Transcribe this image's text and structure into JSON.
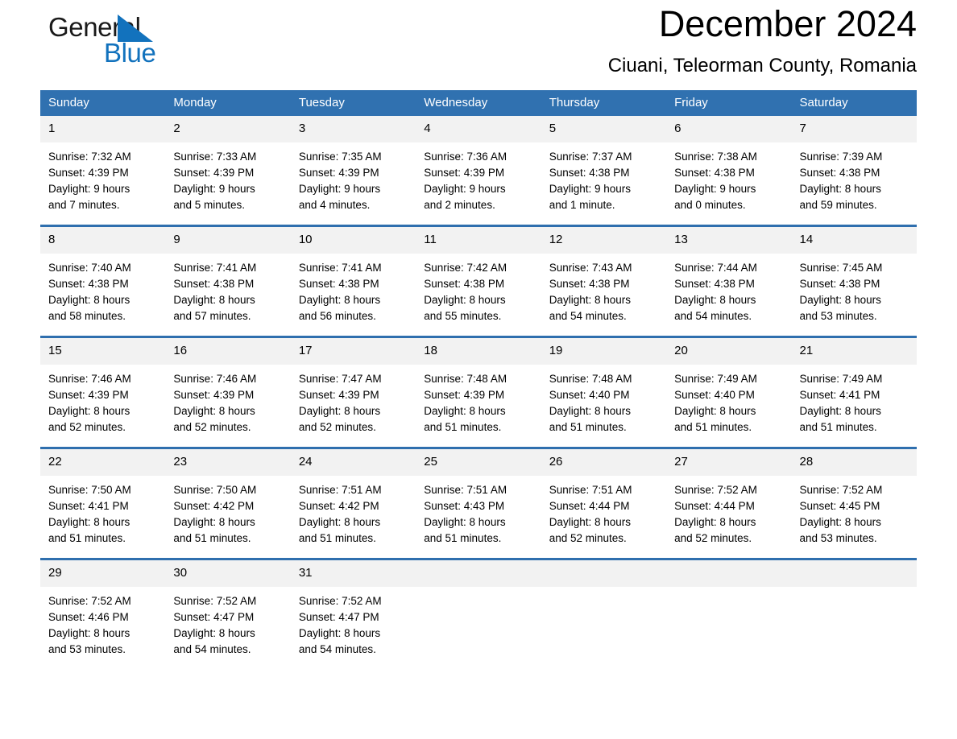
{
  "brand": {
    "line1": "General",
    "line2": "Blue",
    "triangle_color": "#1272bd",
    "text_color": "#1a1a1a"
  },
  "header": {
    "month_title": "December 2024",
    "location": "Ciuani, Teleorman County, Romania"
  },
  "theme": {
    "header_blue": "#3071b0",
    "row_divider_blue": "#2f6fae",
    "daynum_background": "#f2f2f2"
  },
  "weekdays": [
    "Sunday",
    "Monday",
    "Tuesday",
    "Wednesday",
    "Thursday",
    "Friday",
    "Saturday"
  ],
  "weeks": [
    [
      {
        "day": "1",
        "sunrise": "Sunrise: 7:32 AM",
        "sunset": "Sunset: 4:39 PM",
        "daylight_line1": "Daylight: 9 hours",
        "daylight_line2": "and 7 minutes."
      },
      {
        "day": "2",
        "sunrise": "Sunrise: 7:33 AM",
        "sunset": "Sunset: 4:39 PM",
        "daylight_line1": "Daylight: 9 hours",
        "daylight_line2": "and 5 minutes."
      },
      {
        "day": "3",
        "sunrise": "Sunrise: 7:35 AM",
        "sunset": "Sunset: 4:39 PM",
        "daylight_line1": "Daylight: 9 hours",
        "daylight_line2": "and 4 minutes."
      },
      {
        "day": "4",
        "sunrise": "Sunrise: 7:36 AM",
        "sunset": "Sunset: 4:39 PM",
        "daylight_line1": "Daylight: 9 hours",
        "daylight_line2": "and 2 minutes."
      },
      {
        "day": "5",
        "sunrise": "Sunrise: 7:37 AM",
        "sunset": "Sunset: 4:38 PM",
        "daylight_line1": "Daylight: 9 hours",
        "daylight_line2": "and 1 minute."
      },
      {
        "day": "6",
        "sunrise": "Sunrise: 7:38 AM",
        "sunset": "Sunset: 4:38 PM",
        "daylight_line1": "Daylight: 9 hours",
        "daylight_line2": "and 0 minutes."
      },
      {
        "day": "7",
        "sunrise": "Sunrise: 7:39 AM",
        "sunset": "Sunset: 4:38 PM",
        "daylight_line1": "Daylight: 8 hours",
        "daylight_line2": "and 59 minutes."
      }
    ],
    [
      {
        "day": "8",
        "sunrise": "Sunrise: 7:40 AM",
        "sunset": "Sunset: 4:38 PM",
        "daylight_line1": "Daylight: 8 hours",
        "daylight_line2": "and 58 minutes."
      },
      {
        "day": "9",
        "sunrise": "Sunrise: 7:41 AM",
        "sunset": "Sunset: 4:38 PM",
        "daylight_line1": "Daylight: 8 hours",
        "daylight_line2": "and 57 minutes."
      },
      {
        "day": "10",
        "sunrise": "Sunrise: 7:41 AM",
        "sunset": "Sunset: 4:38 PM",
        "daylight_line1": "Daylight: 8 hours",
        "daylight_line2": "and 56 minutes."
      },
      {
        "day": "11",
        "sunrise": "Sunrise: 7:42 AM",
        "sunset": "Sunset: 4:38 PM",
        "daylight_line1": "Daylight: 8 hours",
        "daylight_line2": "and 55 minutes."
      },
      {
        "day": "12",
        "sunrise": "Sunrise: 7:43 AM",
        "sunset": "Sunset: 4:38 PM",
        "daylight_line1": "Daylight: 8 hours",
        "daylight_line2": "and 54 minutes."
      },
      {
        "day": "13",
        "sunrise": "Sunrise: 7:44 AM",
        "sunset": "Sunset: 4:38 PM",
        "daylight_line1": "Daylight: 8 hours",
        "daylight_line2": "and 54 minutes."
      },
      {
        "day": "14",
        "sunrise": "Sunrise: 7:45 AM",
        "sunset": "Sunset: 4:38 PM",
        "daylight_line1": "Daylight: 8 hours",
        "daylight_line2": "and 53 minutes."
      }
    ],
    [
      {
        "day": "15",
        "sunrise": "Sunrise: 7:46 AM",
        "sunset": "Sunset: 4:39 PM",
        "daylight_line1": "Daylight: 8 hours",
        "daylight_line2": "and 52 minutes."
      },
      {
        "day": "16",
        "sunrise": "Sunrise: 7:46 AM",
        "sunset": "Sunset: 4:39 PM",
        "daylight_line1": "Daylight: 8 hours",
        "daylight_line2": "and 52 minutes."
      },
      {
        "day": "17",
        "sunrise": "Sunrise: 7:47 AM",
        "sunset": "Sunset: 4:39 PM",
        "daylight_line1": "Daylight: 8 hours",
        "daylight_line2": "and 52 minutes."
      },
      {
        "day": "18",
        "sunrise": "Sunrise: 7:48 AM",
        "sunset": "Sunset: 4:39 PM",
        "daylight_line1": "Daylight: 8 hours",
        "daylight_line2": "and 51 minutes."
      },
      {
        "day": "19",
        "sunrise": "Sunrise: 7:48 AM",
        "sunset": "Sunset: 4:40 PM",
        "daylight_line1": "Daylight: 8 hours",
        "daylight_line2": "and 51 minutes."
      },
      {
        "day": "20",
        "sunrise": "Sunrise: 7:49 AM",
        "sunset": "Sunset: 4:40 PM",
        "daylight_line1": "Daylight: 8 hours",
        "daylight_line2": "and 51 minutes."
      },
      {
        "day": "21",
        "sunrise": "Sunrise: 7:49 AM",
        "sunset": "Sunset: 4:41 PM",
        "daylight_line1": "Daylight: 8 hours",
        "daylight_line2": "and 51 minutes."
      }
    ],
    [
      {
        "day": "22",
        "sunrise": "Sunrise: 7:50 AM",
        "sunset": "Sunset: 4:41 PM",
        "daylight_line1": "Daylight: 8 hours",
        "daylight_line2": "and 51 minutes."
      },
      {
        "day": "23",
        "sunrise": "Sunrise: 7:50 AM",
        "sunset": "Sunset: 4:42 PM",
        "daylight_line1": "Daylight: 8 hours",
        "daylight_line2": "and 51 minutes."
      },
      {
        "day": "24",
        "sunrise": "Sunrise: 7:51 AM",
        "sunset": "Sunset: 4:42 PM",
        "daylight_line1": "Daylight: 8 hours",
        "daylight_line2": "and 51 minutes."
      },
      {
        "day": "25",
        "sunrise": "Sunrise: 7:51 AM",
        "sunset": "Sunset: 4:43 PM",
        "daylight_line1": "Daylight: 8 hours",
        "daylight_line2": "and 51 minutes."
      },
      {
        "day": "26",
        "sunrise": "Sunrise: 7:51 AM",
        "sunset": "Sunset: 4:44 PM",
        "daylight_line1": "Daylight: 8 hours",
        "daylight_line2": "and 52 minutes."
      },
      {
        "day": "27",
        "sunrise": "Sunrise: 7:52 AM",
        "sunset": "Sunset: 4:44 PM",
        "daylight_line1": "Daylight: 8 hours",
        "daylight_line2": "and 52 minutes."
      },
      {
        "day": "28",
        "sunrise": "Sunrise: 7:52 AM",
        "sunset": "Sunset: 4:45 PM",
        "daylight_line1": "Daylight: 8 hours",
        "daylight_line2": "and 53 minutes."
      }
    ],
    [
      {
        "day": "29",
        "sunrise": "Sunrise: 7:52 AM",
        "sunset": "Sunset: 4:46 PM",
        "daylight_line1": "Daylight: 8 hours",
        "daylight_line2": "and 53 minutes."
      },
      {
        "day": "30",
        "sunrise": "Sunrise: 7:52 AM",
        "sunset": "Sunset: 4:47 PM",
        "daylight_line1": "Daylight: 8 hours",
        "daylight_line2": "and 54 minutes."
      },
      {
        "day": "31",
        "sunrise": "Sunrise: 7:52 AM",
        "sunset": "Sunset: 4:47 PM",
        "daylight_line1": "Daylight: 8 hours",
        "daylight_line2": "and 54 minutes."
      },
      {
        "day": "",
        "sunrise": "",
        "sunset": "",
        "daylight_line1": "",
        "daylight_line2": ""
      },
      {
        "day": "",
        "sunrise": "",
        "sunset": "",
        "daylight_line1": "",
        "daylight_line2": ""
      },
      {
        "day": "",
        "sunrise": "",
        "sunset": "",
        "daylight_line1": "",
        "daylight_line2": ""
      },
      {
        "day": "",
        "sunrise": "",
        "sunset": "",
        "daylight_line1": "",
        "daylight_line2": ""
      }
    ]
  ]
}
